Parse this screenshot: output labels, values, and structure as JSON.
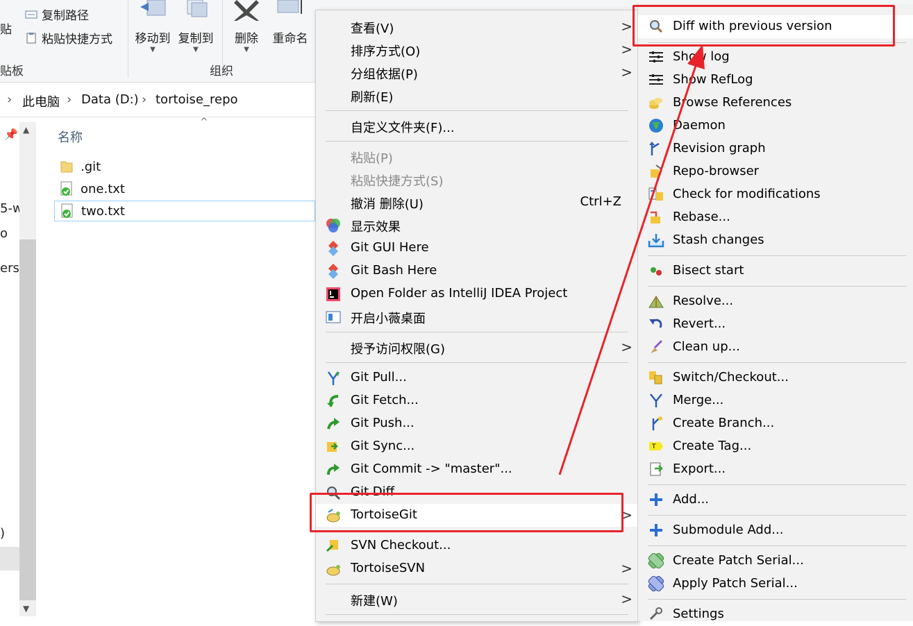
{
  "ribbon": {
    "copy_path": "复制路径",
    "paste_shortcut": "粘贴快捷方式",
    "paste_partial": "贴",
    "clipboard_partial": "贴板",
    "move_to": "移动到",
    "copy_to": "复制到",
    "delete": "删除",
    "rename": "重命名",
    "organize": "组织"
  },
  "address": {
    "crumbs": [
      "此电脑",
      "Data (D:)",
      "tortoise_repo"
    ]
  },
  "nav": {
    "partial_items": [
      "5-w",
      "o",
      "ersc",
      ")"
    ]
  },
  "filelist": {
    "column_name": "名称",
    "files": [
      {
        "name": ".git",
        "type": "folder"
      },
      {
        "name": "one.txt",
        "type": "versioned"
      },
      {
        "name": "two.txt",
        "type": "versioned"
      }
    ]
  },
  "context_menu": {
    "items": [
      {
        "label": "查看(V)",
        "arrow": ">"
      },
      {
        "label": "排序方式(O)",
        "arrow": ">"
      },
      {
        "label": "分组依据(P)",
        "arrow": ">"
      },
      {
        "label": "刷新(E)"
      },
      {
        "label": "自定义文件夹(F)..."
      },
      {
        "label": "粘贴(P)"
      },
      {
        "label": "粘贴快捷方式(S)"
      },
      {
        "label": "撤消 删除(U)",
        "shortcut": "Ctrl+Z"
      },
      {
        "label": "显示效果"
      },
      {
        "label": "Git GUI Here"
      },
      {
        "label": "Git Bash Here"
      },
      {
        "label": "Open Folder as IntelliJ IDEA Project"
      },
      {
        "label": "开启小薇桌面"
      },
      {
        "label": "授予访问权限(G)",
        "arrow": ">"
      },
      {
        "label": "Git Pull..."
      },
      {
        "label": "Git Fetch..."
      },
      {
        "label": "Git Push..."
      },
      {
        "label": "Git Sync..."
      },
      {
        "label": "Git Commit -> \"master\"..."
      },
      {
        "label": "Git Diff"
      },
      {
        "label": "TortoiseGit",
        "arrow": ">"
      },
      {
        "label": "SVN Checkout..."
      },
      {
        "label": "TortoiseSVN",
        "arrow": ">"
      },
      {
        "label": "新建(W)",
        "arrow": ">"
      }
    ]
  },
  "submenu": {
    "items": [
      {
        "label": "Diff with previous version",
        "icon": "magnifier-icon"
      },
      {
        "label": "Show log",
        "icon": "log-icon"
      },
      {
        "label": "Show RefLog",
        "icon": "reflog-icon"
      },
      {
        "label": "Browse References",
        "icon": "references-icon"
      },
      {
        "label": "Daemon",
        "icon": "globe-icon"
      },
      {
        "label": "Revision graph",
        "icon": "graph-icon"
      },
      {
        "label": "Repo-browser",
        "icon": "repo-browser-icon"
      },
      {
        "label": "Check for modifications",
        "icon": "check-modifications-icon"
      },
      {
        "label": "Rebase...",
        "icon": "rebase-icon"
      },
      {
        "label": "Stash changes",
        "icon": "stash-icon"
      },
      {
        "label": "Bisect start",
        "icon": "bisect-icon"
      },
      {
        "label": "Resolve...",
        "icon": "resolve-icon"
      },
      {
        "label": "Revert...",
        "icon": "revert-icon"
      },
      {
        "label": "Clean up...",
        "icon": "broom-icon"
      },
      {
        "label": "Switch/Checkout...",
        "icon": "switch-icon"
      },
      {
        "label": "Merge...",
        "icon": "merge-icon"
      },
      {
        "label": "Create Branch...",
        "icon": "branch-icon"
      },
      {
        "label": "Create Tag...",
        "icon": "tag-icon"
      },
      {
        "label": "Export...",
        "icon": "export-icon"
      },
      {
        "label": "Add...",
        "icon": "plus-icon"
      },
      {
        "label": "Submodule Add...",
        "icon": "plus-icon"
      },
      {
        "label": "Create Patch Serial...",
        "icon": "patch-create-icon"
      },
      {
        "label": "Apply Patch Serial...",
        "icon": "patch-apply-icon"
      },
      {
        "label": "Settings",
        "icon": "settings-icon"
      }
    ]
  },
  "colors": {
    "annotation_red": "#e8242a",
    "menu_bg": "#f2f2f2",
    "selection_border": "#99d1ff"
  }
}
